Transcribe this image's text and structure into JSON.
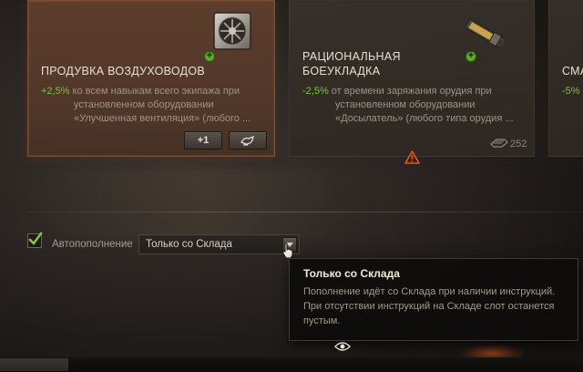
{
  "cards": [
    {
      "title": "ПРОДУВКА ВОЗДУХОВОДОВ",
      "bonus": "+2,5%",
      "desc_line1": " ко всем навыкам всего экипажа при",
      "desc_line2": "установленном оборудовании",
      "desc_line3": "«Улучшенная вентиляция» (любого ...",
      "item_icon": "ventilation-fan-icon",
      "buttons": [
        {
          "label": "+1"
        },
        {
          "label": "",
          "icon": "pour-icon"
        }
      ]
    },
    {
      "title_line1": "РАЦИОНАЛЬНАЯ",
      "title_line2": "БОЕУКЛАДКА",
      "bonus": "-2,5%",
      "desc_line1": " от времени заряжания орудия при",
      "desc_line2": "установленном оборудовании",
      "desc_line3": "«Досылатель» (любого типа орудия ...",
      "item_icon": "rammer-icon",
      "stock_count": "252",
      "stock_icon": "stock-icon"
    },
    {
      "title": "СМА",
      "bonus": "-5%"
    }
  ],
  "warning_icon": "warning-triangle-icon",
  "autofill": {
    "checked": true,
    "label": "Автопополнение",
    "dropdown_value": "Только со Склада"
  },
  "tooltip": {
    "title": "Только со Склада",
    "line1": "Пополнение идёт со Склада при наличии инструкций.",
    "line2": "При отсутствии инструкций на Складе слот останется",
    "line3": "пустым."
  },
  "colors": {
    "bonus_green": "#7bc142",
    "selected_card": "#7a4e34",
    "warning_orange": "#e05a1c"
  }
}
